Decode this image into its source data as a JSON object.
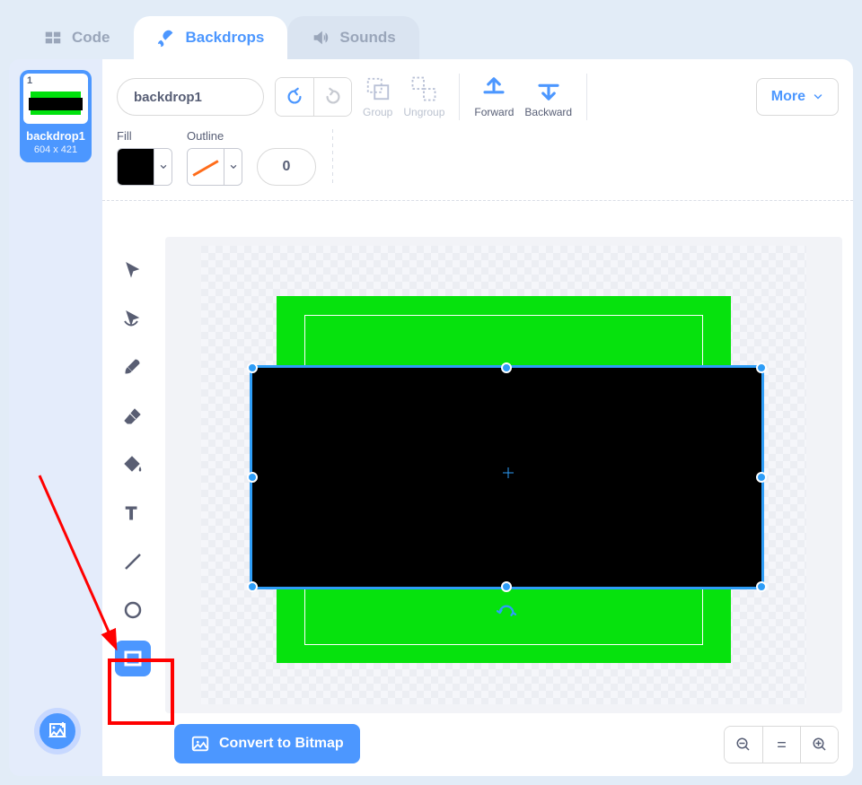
{
  "tabs": {
    "code": "Code",
    "backdrops": "Backdrops",
    "sounds": "Sounds"
  },
  "sidebar": {
    "thumb_number": "1",
    "thumb_name": "backdrop1",
    "thumb_dims": "604 x 421"
  },
  "name_input": {
    "value": "backdrop1"
  },
  "actions": {
    "group": "Group",
    "ungroup": "Ungroup",
    "forward": "Forward",
    "backward": "Backward"
  },
  "more_label": "More",
  "fields": {
    "fill_label": "Fill",
    "outline_label": "Outline",
    "outline_width": "0"
  },
  "tools": {
    "select": "select-tool",
    "reshape": "reshape-tool",
    "brush": "brush-tool",
    "eraser": "eraser-tool",
    "fill": "fill-tool",
    "text": "text-tool",
    "line": "line-tool",
    "circle": "circle-tool",
    "rect": "rect-tool"
  },
  "convert_label": "Convert to Bitmap",
  "zoom": {
    "out": "−",
    "reset": "=",
    "in": "+"
  },
  "colors": {
    "green": "#06e20d",
    "black": "#000000",
    "selection": "#2e9df7"
  }
}
